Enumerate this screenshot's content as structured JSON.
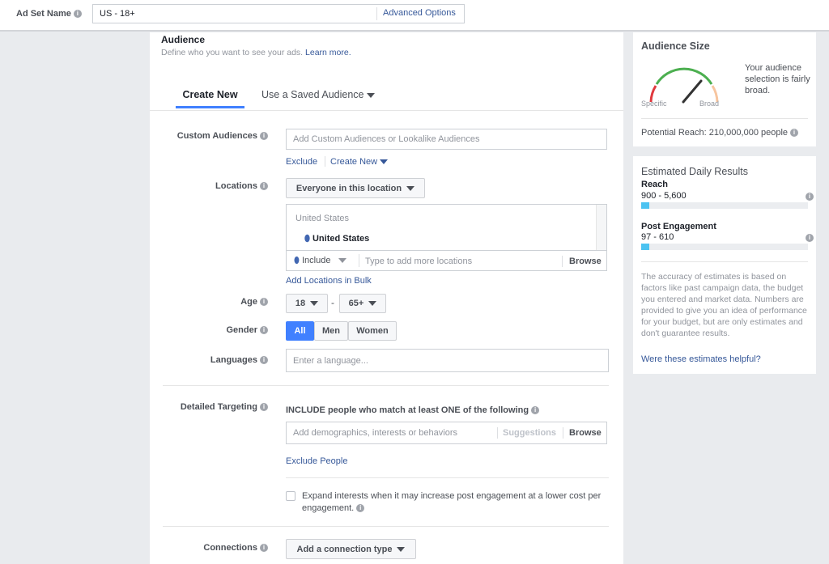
{
  "header": {
    "ad_set_name_label": "Ad Set Name",
    "ad_set_name_value": "US - 18+",
    "advanced_options": "Advanced Options"
  },
  "audience": {
    "title": "Audience",
    "subtitle": "Define who you want to see your ads.",
    "learn_more": "Learn more.",
    "tabs": [
      {
        "label": "Create New",
        "active": true
      },
      {
        "label": "Use a Saved Audience",
        "active": false
      }
    ],
    "custom_audiences": {
      "label": "Custom Audiences",
      "placeholder": "Add Custom Audiences or Lookalike Audiences",
      "exclude": "Exclude",
      "create_new": "Create New"
    },
    "locations": {
      "label": "Locations",
      "type": "Everyone in this location",
      "group": "United States",
      "selected": "United States",
      "include": "Include",
      "placeholder": "Type to add more locations",
      "browse": "Browse",
      "bulk": "Add Locations in Bulk"
    },
    "age": {
      "label": "Age",
      "min": "18",
      "sep": "-",
      "max": "65+"
    },
    "gender": {
      "label": "Gender",
      "options": [
        "All",
        "Men",
        "Women"
      ],
      "selected": "All"
    },
    "languages": {
      "label": "Languages",
      "placeholder": "Enter a language..."
    },
    "detailed": {
      "label": "Detailed Targeting",
      "include_text": "INCLUDE people who match at least ONE of the following",
      "placeholder": "Add demographics, interests or behaviors",
      "suggestions": "Suggestions",
      "browse": "Browse",
      "exclude": "Exclude People",
      "expand_text": "Expand interests when it may increase post engagement at a lower cost per engagement.",
      "expand_checked": false
    },
    "connections": {
      "label": "Connections",
      "button": "Add a connection type"
    }
  },
  "audience_size": {
    "title": "Audience Size",
    "specific": "Specific",
    "broad": "Broad",
    "description": "Your audience selection is fairly broad.",
    "potential_reach": "Potential Reach: 210,000,000 people"
  },
  "estimates": {
    "title": "Estimated Daily Results",
    "reach_label": "Reach",
    "reach_value": "900 - 5,600",
    "reach_fill_pct": 5,
    "engagement_label": "Post Engagement",
    "engagement_value": "97 - 610",
    "engagement_fill_pct": 5,
    "disclaimer": "The accuracy of estimates is based on factors like past campaign data, the budget you entered and market data. Numbers are provided to give you an idea of performance for your budget, but are only estimates and don't guarantee results.",
    "feedback": "Were these estimates helpful?"
  },
  "colors": {
    "accent": "#4080ff",
    "link": "#365899",
    "gauge_green": "#4caf50",
    "gauge_red": "#e0393e",
    "gauge_orange": "#f7c59f",
    "bar_fill": "#4cc3f1"
  }
}
